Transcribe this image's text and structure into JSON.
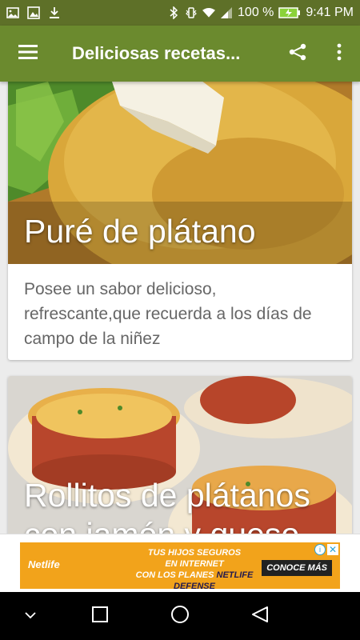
{
  "status_bar": {
    "battery_text": "100 %",
    "time": "9:41 PM",
    "icons": [
      "image-icon",
      "gallery-icon",
      "download-icon",
      "bluetooth-icon",
      "vibrate-icon",
      "wifi-icon",
      "signal-icon",
      "battery-icon"
    ]
  },
  "app_bar": {
    "title": "Deliciosas recetas...",
    "icons": [
      "menu-icon",
      "share-icon",
      "more-vert-icon"
    ]
  },
  "cards": [
    {
      "title": "Puré de plátano",
      "description": "Posee un sabor delicioso, refrescante,que recuerda a los días de campo de la niñez"
    },
    {
      "title": "Rollitos de plátanos con jamón y queso",
      "description": ""
    }
  ],
  "ad": {
    "logo": "Netlife",
    "line1": "TUS HIJOS SEGUROS",
    "line2": "EN INTERNET",
    "line3": "CON LOS PLANES",
    "line3_highlight": "NETLIFE DEFENSE",
    "cta": "CONOCE MÁS",
    "info_glyph": "i",
    "close_glyph": "✕"
  },
  "nav_bar": {
    "icons": [
      "chevron-down-icon",
      "recents-icon",
      "home-icon",
      "back-icon"
    ]
  },
  "colors": {
    "status_bar": "#5e7028",
    "app_bar": "#6b8a2e",
    "ad_background": "#f2a31b"
  }
}
